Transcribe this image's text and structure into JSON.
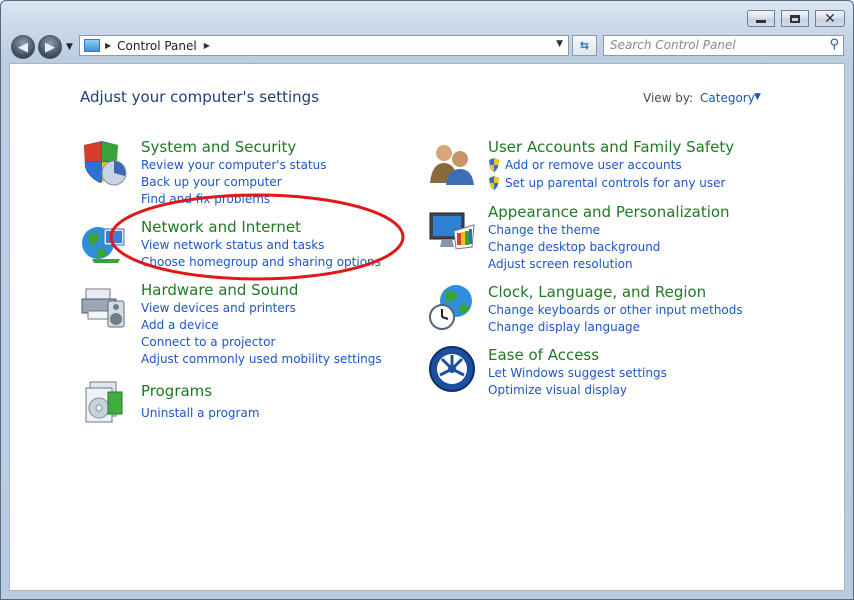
{
  "address": {
    "breadcrumb": "Control Panel",
    "search_placeholder": "Search Control Panel"
  },
  "page": {
    "heading": "Adjust your computer's settings",
    "view_by_label": "View by:",
    "view_by_value": "Category"
  },
  "categories": {
    "system_security": {
      "title": "System and Security",
      "links": [
        "Review your computer's status",
        "Back up your computer",
        "Find and fix problems"
      ]
    },
    "network_internet": {
      "title": "Network and Internet",
      "links": [
        "View network status and tasks",
        "Choose homegroup and sharing options"
      ]
    },
    "hardware_sound": {
      "title": "Hardware and Sound",
      "links": [
        "View devices and printers",
        "Add a device",
        "Connect to a projector",
        "Adjust commonly used mobility settings"
      ]
    },
    "programs": {
      "title": "Programs",
      "links": [
        "Uninstall a program"
      ]
    },
    "user_accounts": {
      "title": "User Accounts and Family Safety",
      "links": [
        "Add or remove user accounts",
        "Set up parental controls for any user"
      ]
    },
    "appearance": {
      "title": "Appearance and Personalization",
      "links": [
        "Change the theme",
        "Change desktop background",
        "Adjust screen resolution"
      ]
    },
    "clock_language": {
      "title": "Clock, Language, and Region",
      "links": [
        "Change keyboards or other input methods",
        "Change display language"
      ]
    },
    "ease_access": {
      "title": "Ease of Access",
      "links": [
        "Let Windows suggest settings",
        "Optimize visual display"
      ]
    }
  },
  "colors": {
    "category_title": "#1e7a22",
    "link": "#1c56c7",
    "heading": "#1e3f77",
    "annotation": "#e01818"
  }
}
